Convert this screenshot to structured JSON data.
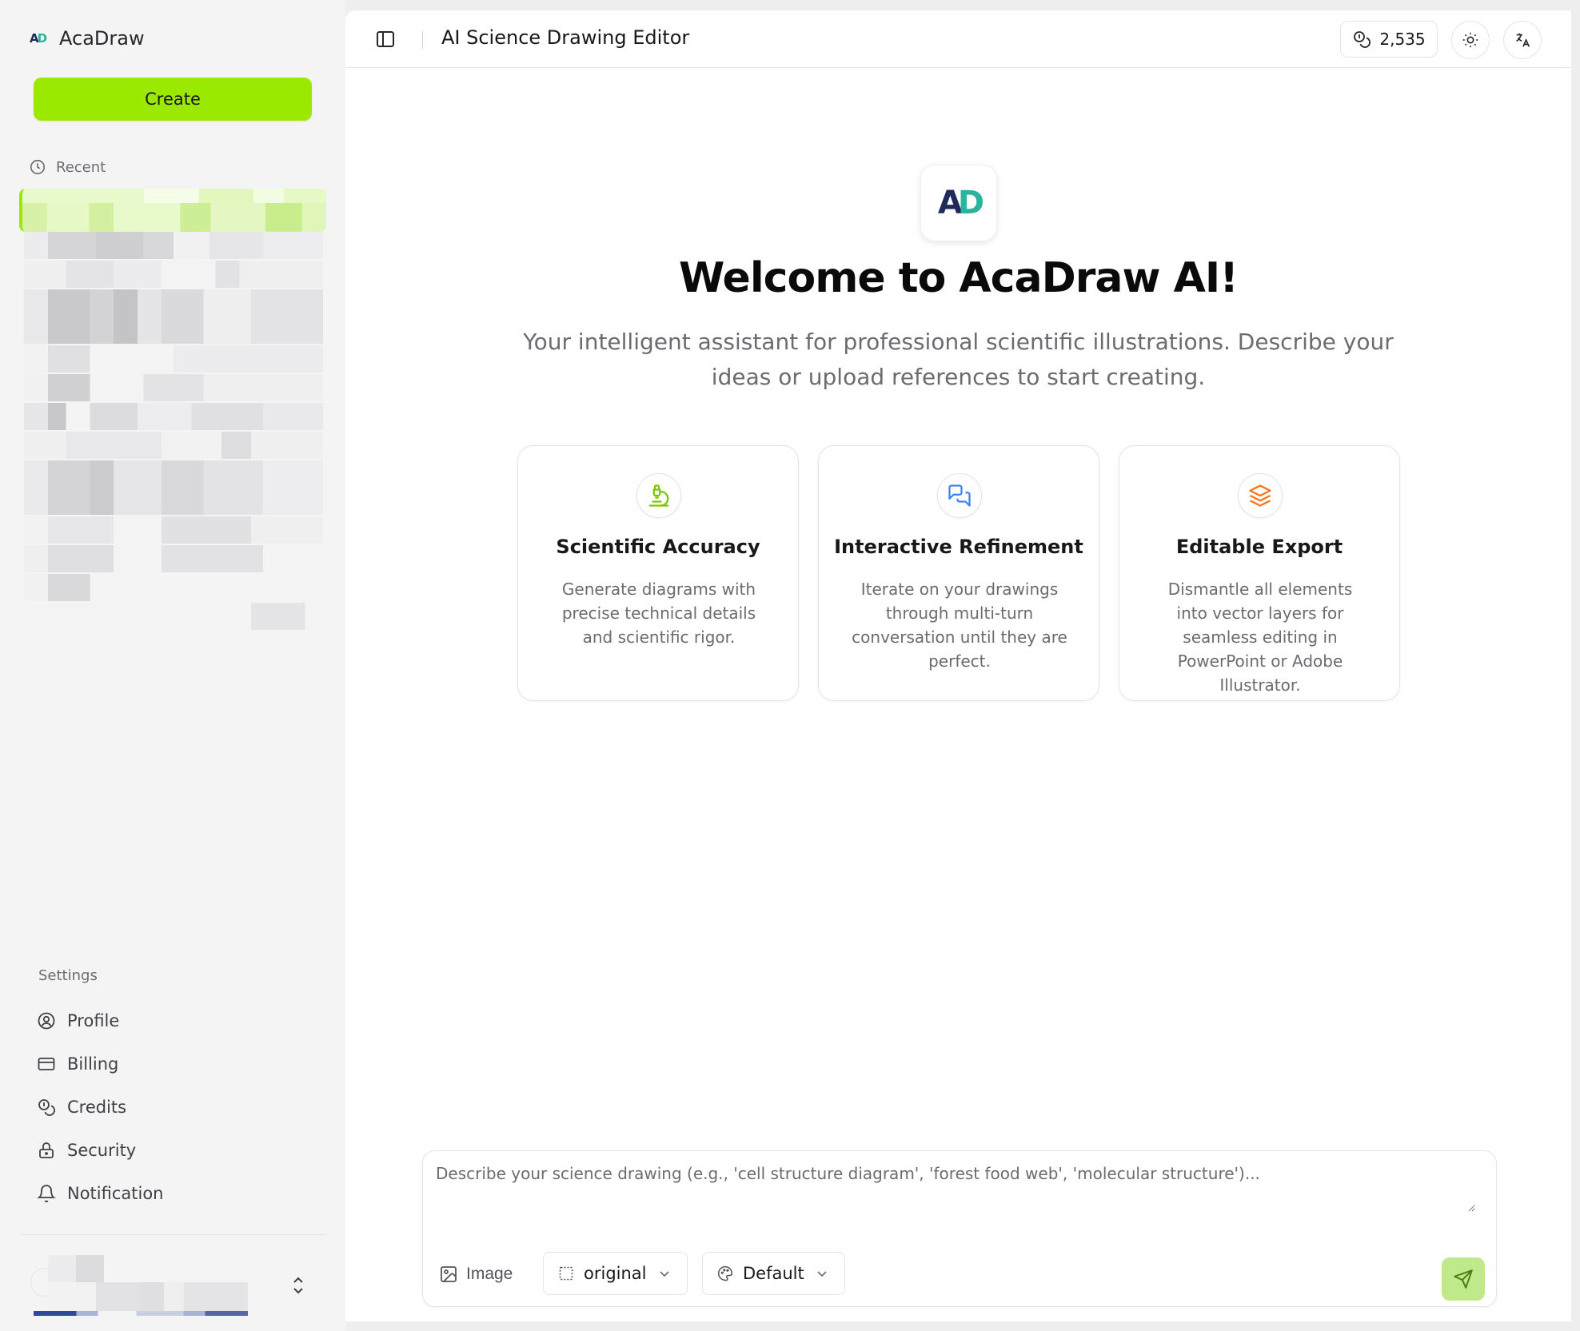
{
  "app": {
    "name": "AcaDraw",
    "logo_letters": [
      "A",
      "D"
    ]
  },
  "sidebar": {
    "create_label": "Create",
    "recent_label": "Recent",
    "settings_label": "Settings",
    "settings_items": [
      {
        "label": "Profile",
        "icon": "profile-icon"
      },
      {
        "label": "Billing",
        "icon": "credit-card-icon"
      },
      {
        "label": "Credits",
        "icon": "coins-icon"
      },
      {
        "label": "Security",
        "icon": "lock-icon"
      },
      {
        "label": "Notification",
        "icon": "bell-icon"
      }
    ]
  },
  "topbar": {
    "title": "AI Science Drawing Editor",
    "credits": "2,535"
  },
  "hero": {
    "title": "Welcome to AcaDraw AI!",
    "subtitle": "Your intelligent assistant for professional scientific illustrations. Describe your ideas or upload references to start creating."
  },
  "features": [
    {
      "title": "Scientific Accuracy",
      "description": "Generate diagrams with precise technical details and scientific rigor.",
      "icon": "microscope-icon",
      "color": "#7cc600"
    },
    {
      "title": "Interactive Refinement",
      "description": "Iterate on your drawings through multi-turn conversation until they are perfect.",
      "icon": "chat-icon",
      "color": "#3b82f6"
    },
    {
      "title": "Editable Export",
      "description": "Dismantle all elements into vector layers for seamless editing in PowerPoint or Adobe Illustrator.",
      "icon": "layers-icon",
      "color": "#f97316"
    }
  ],
  "composer": {
    "placeholder": "Describe your science drawing (e.g., 'cell structure diagram', 'forest food web', 'molecular structure')...",
    "image_label": "Image",
    "aspect_value": "original",
    "style_value": "Default"
  },
  "colors": {
    "accent": "#9be800",
    "send": "#bfe98a"
  }
}
